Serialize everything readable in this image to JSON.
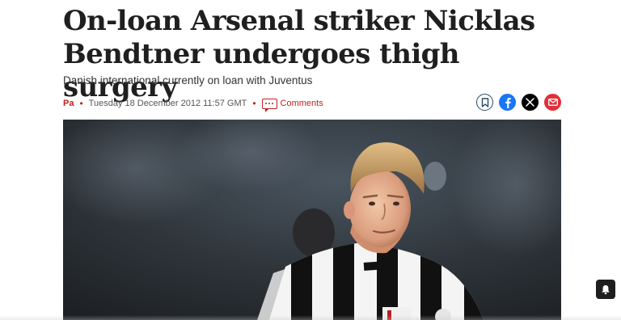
{
  "article": {
    "headline": "On-loan Arsenal striker Nicklas Bendtner undergoes thigh surgery",
    "standfirst": "Danish international currently on loan with Juventus",
    "author": "Pa",
    "published": "Tuesday 18 December 2012 11:57 GMT",
    "comments_label": "Comments"
  },
  "share": {
    "icons": [
      "bookmark-icon",
      "facebook-icon",
      "x-icon",
      "email-icon"
    ]
  },
  "hero_image": {
    "subject": "footballer in black and white striped jersey"
  },
  "colors": {
    "accent": "#c41e1e",
    "facebook": "#1877f2",
    "x": "#000000",
    "email": "#e0303a"
  }
}
